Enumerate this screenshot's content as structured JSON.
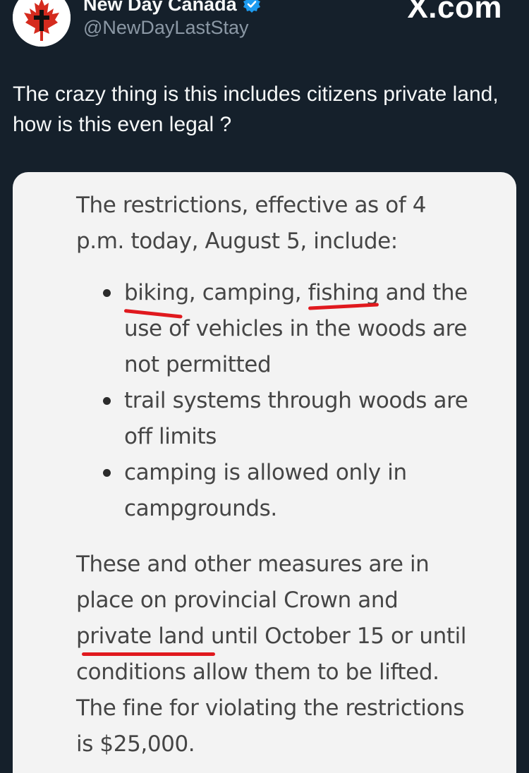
{
  "author": {
    "display_name": "New Day Canada",
    "handle": "@NewDayLastStay",
    "verified": true,
    "avatar_icon": "canada-maple-leaf-cross-icon"
  },
  "source_watermark": "X.com",
  "tweet": {
    "text": "The crazy thing is this includes citizens private land, how is this even legal ?"
  },
  "article": {
    "intro": "The restrictions, effective as of 4 p.m. today, August 5, include:",
    "bullet_1": {
      "w_biking": "biking",
      "t_mid_1": ", camping, ",
      "w_fishing": "fishing",
      "t_rest": " and the use of vehicles in the woods are not permitted"
    },
    "bullet_2": "trail systems through woods are off limits",
    "bullet_3": "camping is allowed only in campgrounds.",
    "body": {
      "t_start": "These and other measures are in place on provincial Crown and ",
      "w_private_land": "private land",
      "t_rest": " until October 15 or until conditions allow them to be lifted. The fine for violating the restrictions is $25,000."
    }
  },
  "colors": {
    "background": "#15202b",
    "card_background": "#f3f3f3",
    "underline_red": "#e0191e",
    "verified_blue": "#1d9bf0",
    "maple_red": "#d52b1e"
  }
}
